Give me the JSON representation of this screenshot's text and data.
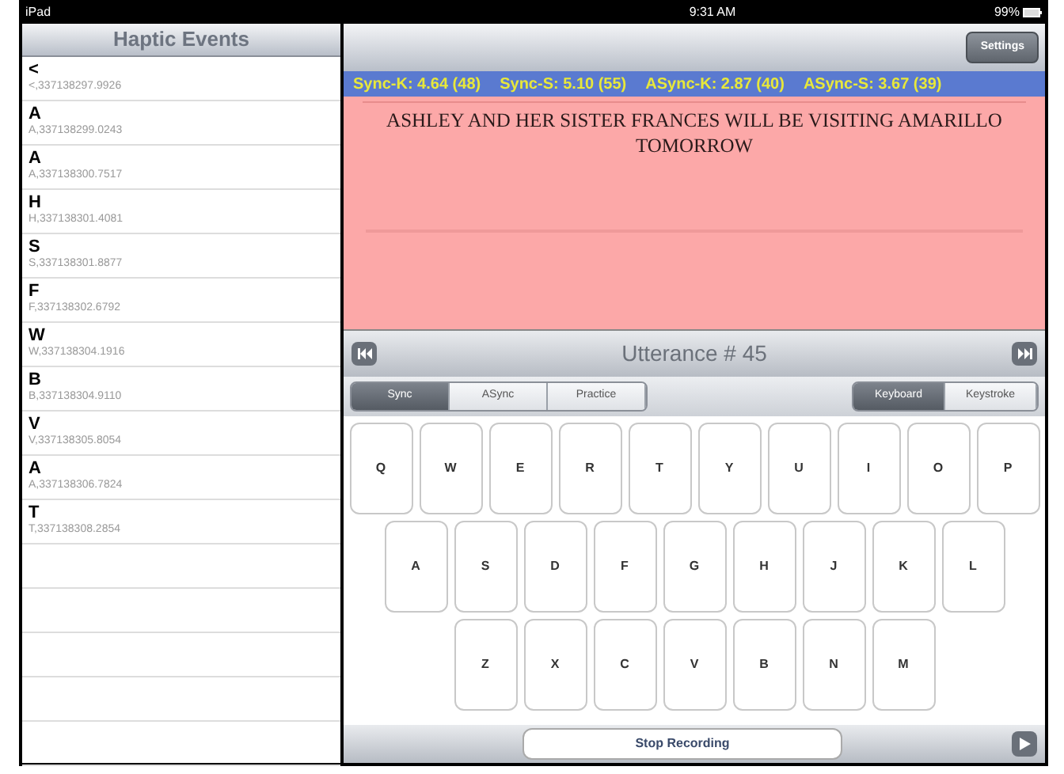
{
  "status_bar": {
    "carrier": "iPad",
    "time": "9:31 AM",
    "battery": "99%"
  },
  "sidebar": {
    "title": "Haptic Events",
    "items": [
      {
        "letter": "<",
        "detail": "<,337138297.9926"
      },
      {
        "letter": "A",
        "detail": "A,337138299.0243"
      },
      {
        "letter": "A",
        "detail": "A,337138300.7517"
      },
      {
        "letter": "H",
        "detail": "H,337138301.4081"
      },
      {
        "letter": "S",
        "detail": "S,337138301.8877"
      },
      {
        "letter": "F",
        "detail": "F,337138302.6792"
      },
      {
        "letter": "W",
        "detail": "W,337138304.1916"
      },
      {
        "letter": "B",
        "detail": "B,337138304.9110"
      },
      {
        "letter": "V",
        "detail": "V,337138305.8054"
      },
      {
        "letter": "A",
        "detail": "A,337138306.7824"
      },
      {
        "letter": "T",
        "detail": "T,337138308.2854"
      }
    ]
  },
  "toolbar": {
    "settings": "Settings"
  },
  "stats": [
    "Sync-K: 4.64 (48)",
    "Sync-S: 5.10 (55)",
    "ASync-K: 2.87 (40)",
    "ASync-S: 3.67 (39)"
  ],
  "prompt": "ASHLEY AND HER SISTER FRANCES WILL BE VISITING AMARILLO TOMORROW",
  "utterance": "Utterance # 45",
  "mode_tabs": [
    {
      "label": "Sync",
      "selected": true
    },
    {
      "label": "ASync",
      "selected": false
    },
    {
      "label": "Practice",
      "selected": false
    }
  ],
  "input_tabs": [
    {
      "label": "Keyboard",
      "selected": true
    },
    {
      "label": "Keystroke",
      "selected": false
    }
  ],
  "keyboard": [
    [
      "Q",
      "W",
      "E",
      "R",
      "T",
      "Y",
      "U",
      "I",
      "O",
      "P"
    ],
    [
      "A",
      "S",
      "D",
      "F",
      "G",
      "H",
      "J",
      "K",
      "L"
    ],
    [
      "Z",
      "X",
      "C",
      "V",
      "B",
      "N",
      "M"
    ]
  ],
  "stop_button": "Stop Recording"
}
